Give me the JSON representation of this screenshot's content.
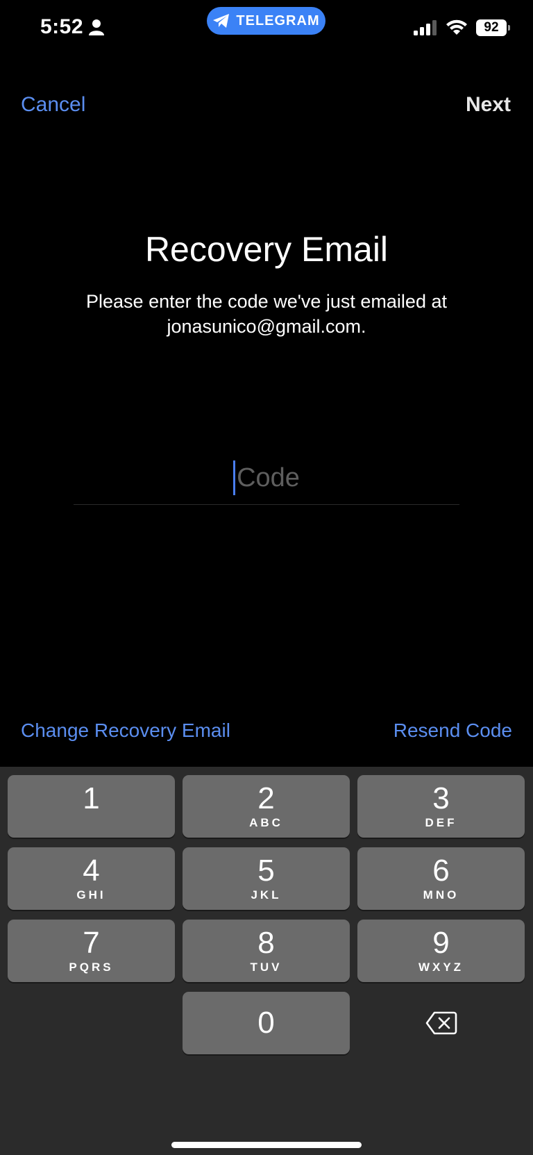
{
  "status_bar": {
    "time": "5:52",
    "app_pill": "TELEGRAM",
    "battery": "92"
  },
  "nav": {
    "cancel": "Cancel",
    "next": "Next"
  },
  "main": {
    "title": "Recovery Email",
    "subtitle": "Please enter the code we've just emailed at jonasunico@gmail.com.",
    "code_placeholder": "Code"
  },
  "links": {
    "change_email": "Change Recovery Email",
    "resend_code": "Resend Code"
  },
  "keypad": {
    "keys": [
      {
        "num": "1",
        "letters": ""
      },
      {
        "num": "2",
        "letters": "ABC"
      },
      {
        "num": "3",
        "letters": "DEF"
      },
      {
        "num": "4",
        "letters": "GHI"
      },
      {
        "num": "5",
        "letters": "JKL"
      },
      {
        "num": "6",
        "letters": "MNO"
      },
      {
        "num": "7",
        "letters": "PQRS"
      },
      {
        "num": "8",
        "letters": "TUV"
      },
      {
        "num": "9",
        "letters": "WXYZ"
      },
      {
        "num": "0",
        "letters": ""
      }
    ],
    "backspace_icon": "backspace-icon"
  },
  "colors": {
    "accent": "#5b8ef0",
    "telegram_blue": "#3b82f6",
    "background": "#000000",
    "keyboard_bg": "#2b2b2b",
    "key_bg": "#6b6b6b"
  }
}
